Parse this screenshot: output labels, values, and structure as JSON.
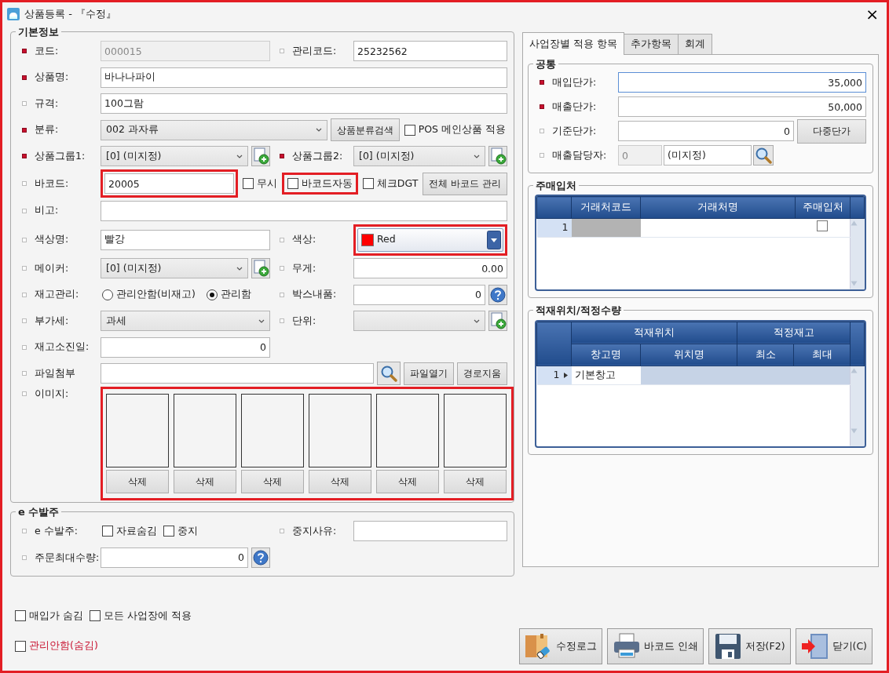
{
  "window": {
    "title": "상품등록 - 『수정』",
    "close": "×",
    "highlighted": true
  },
  "basic_info": {
    "title": "기본정보",
    "rows": [
      {
        "label": {
          "text": "코드:",
          "required": true
        },
        "controls": [
          {
            "kind": "input",
            "value": "000015",
            "disabled": true
          }
        ],
        "right": {
          "label": {
            "text": "관리코드:",
            "required": false
          },
          "controls": [
            {
              "kind": "input",
              "value": "25232562"
            }
          ]
        }
      },
      {
        "label": {
          "text": "상품명:",
          "required": true
        },
        "controls": [
          {
            "kind": "input",
            "value": "바나나파이"
          }
        ]
      },
      {
        "label": {
          "text": "규격:",
          "required": false
        },
        "controls": [
          {
            "kind": "input",
            "value": "100그람"
          }
        ]
      },
      {
        "label": {
          "text": "분류:",
          "required": true
        },
        "controls": [
          {
            "kind": "combo",
            "value": "002 과자류"
          },
          {
            "kind": "button",
            "label": "상품분류검색"
          },
          {
            "kind": "checkbox",
            "label": "POS 메인상품 적용",
            "checked": false
          }
        ]
      },
      {
        "label": {
          "text": "상품그룹1:",
          "required": true
        },
        "controls": [
          {
            "kind": "combo",
            "value": "[0] (미지정)"
          },
          {
            "kind": "add"
          }
        ],
        "right": {
          "label": {
            "text": "상품그룹2:",
            "required": true
          },
          "controls": [
            {
              "kind": "combo",
              "value": "[0] (미지정)"
            },
            {
              "kind": "add"
            }
          ]
        }
      },
      {
        "label": {
          "text": "바코드:",
          "required": false
        },
        "controls": [
          {
            "kind": "input",
            "value": "20005",
            "highlighted": true
          },
          {
            "kind": "checkbox",
            "label": "무시",
            "checked": false
          },
          {
            "kind": "checkbox",
            "label": "바코드자동",
            "checked": false,
            "highlighted": true
          },
          {
            "kind": "checkbox",
            "label": "체크DGT",
            "checked": false
          },
          {
            "kind": "button",
            "label": "전체 바코드 관리"
          }
        ]
      },
      {
        "label": {
          "text": "비고:",
          "required": false
        },
        "controls": [
          {
            "kind": "input"
          }
        ]
      },
      {
        "label": {
          "text": "색상명:",
          "required": false
        },
        "controls": [
          {
            "kind": "input",
            "value": "빨강"
          }
        ],
        "right": {
          "label": {
            "text": "색상:",
            "required": false
          },
          "controls": [
            {
              "kind": "color",
              "value": "Red",
              "color": "#ff0000",
              "highlighted": true
            }
          ]
        }
      },
      {
        "label": {
          "text": "메이커:",
          "required": false
        },
        "controls": [
          {
            "kind": "combo",
            "value": "[0] (미지정)"
          },
          {
            "kind": "add"
          }
        ],
        "right": {
          "label": {
            "text": "무게:",
            "required": false
          },
          "controls": [
            {
              "kind": "input",
              "value": "0.00",
              "numeric": true
            }
          ]
        }
      },
      {
        "label": {
          "text": "재고관리:",
          "required": false
        },
        "controls": [
          {
            "kind": "radio",
            "label": "관리안함(비재고)",
            "selected": false
          },
          {
            "kind": "radio",
            "label": "관리함",
            "selected": true
          }
        ],
        "right": {
          "label": {
            "text": "박스내품:",
            "required": false
          },
          "controls": [
            {
              "kind": "input",
              "value": "0",
              "numeric": true
            },
            {
              "kind": "help"
            }
          ]
        }
      },
      {
        "label": {
          "text": "부가세:",
          "required": false
        },
        "controls": [
          {
            "kind": "combo",
            "value": "과세"
          }
        ],
        "right": {
          "label": {
            "text": "단위:",
            "required": false
          },
          "controls": [
            {
              "kind": "combo"
            },
            {
              "kind": "add"
            }
          ]
        }
      },
      {
        "label": {
          "text": "재고소진일:",
          "required": false
        },
        "controls": [
          {
            "kind": "input",
            "value": "0",
            "numeric": true
          }
        ]
      },
      {
        "label": {
          "text": "파일첨부",
          "required": false
        },
        "controls": [
          {
            "kind": "input"
          },
          {
            "kind": "search"
          },
          {
            "kind": "button",
            "label": "파일열기"
          },
          {
            "kind": "button",
            "label": "경로지움"
          }
        ]
      },
      {
        "label": {
          "text": "이미지:",
          "required": false
        },
        "controls": [
          {
            "kind": "images",
            "highlighted": true,
            "slots": [
              {
                "button": "삭제"
              },
              {
                "button": "삭제"
              },
              {
                "button": "삭제"
              },
              {
                "button": "삭제"
              },
              {
                "button": "삭제"
              },
              {
                "button": "삭제"
              }
            ]
          }
        ]
      }
    ]
  },
  "e_order": {
    "title": "e 수발주",
    "rows": [
      {
        "label": {
          "text": "e 수발주:",
          "required": false
        },
        "controls": [
          {
            "kind": "checkbox",
            "label": "자료숨김",
            "checked": false
          },
          {
            "kind": "checkbox",
            "label": "중지",
            "checked": false
          }
        ],
        "right": {
          "label": {
            "text": "중지사유:",
            "required": false
          },
          "controls": [
            {
              "kind": "input"
            }
          ]
        }
      },
      {
        "label": {
          "text": "주문최대수량:",
          "required": false
        },
        "controls": [
          {
            "kind": "input",
            "value": "0",
            "numeric": true
          },
          {
            "kind": "help"
          }
        ]
      }
    ]
  },
  "option_rows": [
    {
      "items": [
        {
          "label": "매입가 숨김",
          "checked": false,
          "danger": false
        },
        {
          "label": "모든 사업장에 적용",
          "checked": false,
          "danger": false
        }
      ]
    },
    {
      "items": [
        {
          "label": "관리안함(숨김)",
          "checked": false,
          "danger": true
        }
      ]
    }
  ],
  "actions": [
    {
      "kind": "log",
      "label": "수정로그"
    },
    {
      "kind": "print",
      "label": "바코드 인쇄"
    },
    {
      "kind": "save",
      "label": "저장(F2)"
    },
    {
      "kind": "close",
      "label": "닫기(C)"
    }
  ],
  "tabs": [
    {
      "label": "사업장별 적용 항목",
      "selected": true
    },
    {
      "label": "추가항목",
      "selected": false
    },
    {
      "label": "회계",
      "selected": false
    }
  ],
  "common": {
    "title": "공통",
    "rows": [
      {
        "kind": "price",
        "label": {
          "text": "매입단가:",
          "required": true
        },
        "value": "35,000",
        "focused": true
      },
      {
        "kind": "price",
        "label": {
          "text": "매출단가:",
          "required": true
        },
        "value": "50,000",
        "focused": false
      },
      {
        "kind": "price",
        "label": {
          "text": "기준단가:",
          "required": false
        },
        "value": "0",
        "focused": false,
        "button": "다중단가"
      },
      {
        "kind": "lookup",
        "label": {
          "text": "매출담당자:",
          "required": false
        },
        "code": "0",
        "name": "(미지정)"
      }
    ]
  },
  "main_supplier": {
    "title": "주매입처",
    "columns": [
      "거래처코드",
      "거래처명",
      "주매입처"
    ],
    "rows": [
      {
        "number": "1",
        "checked": false
      }
    ]
  },
  "location": {
    "title": "적재위치/적정수량",
    "groups": [
      "적재위치",
      "적정재고"
    ],
    "columns": [
      "창고명",
      "위치명",
      "최소",
      "최대"
    ],
    "rows": [
      {
        "number": "1",
        "current": true,
        "selected": true,
        "warehouse": "기본창고"
      }
    ]
  }
}
